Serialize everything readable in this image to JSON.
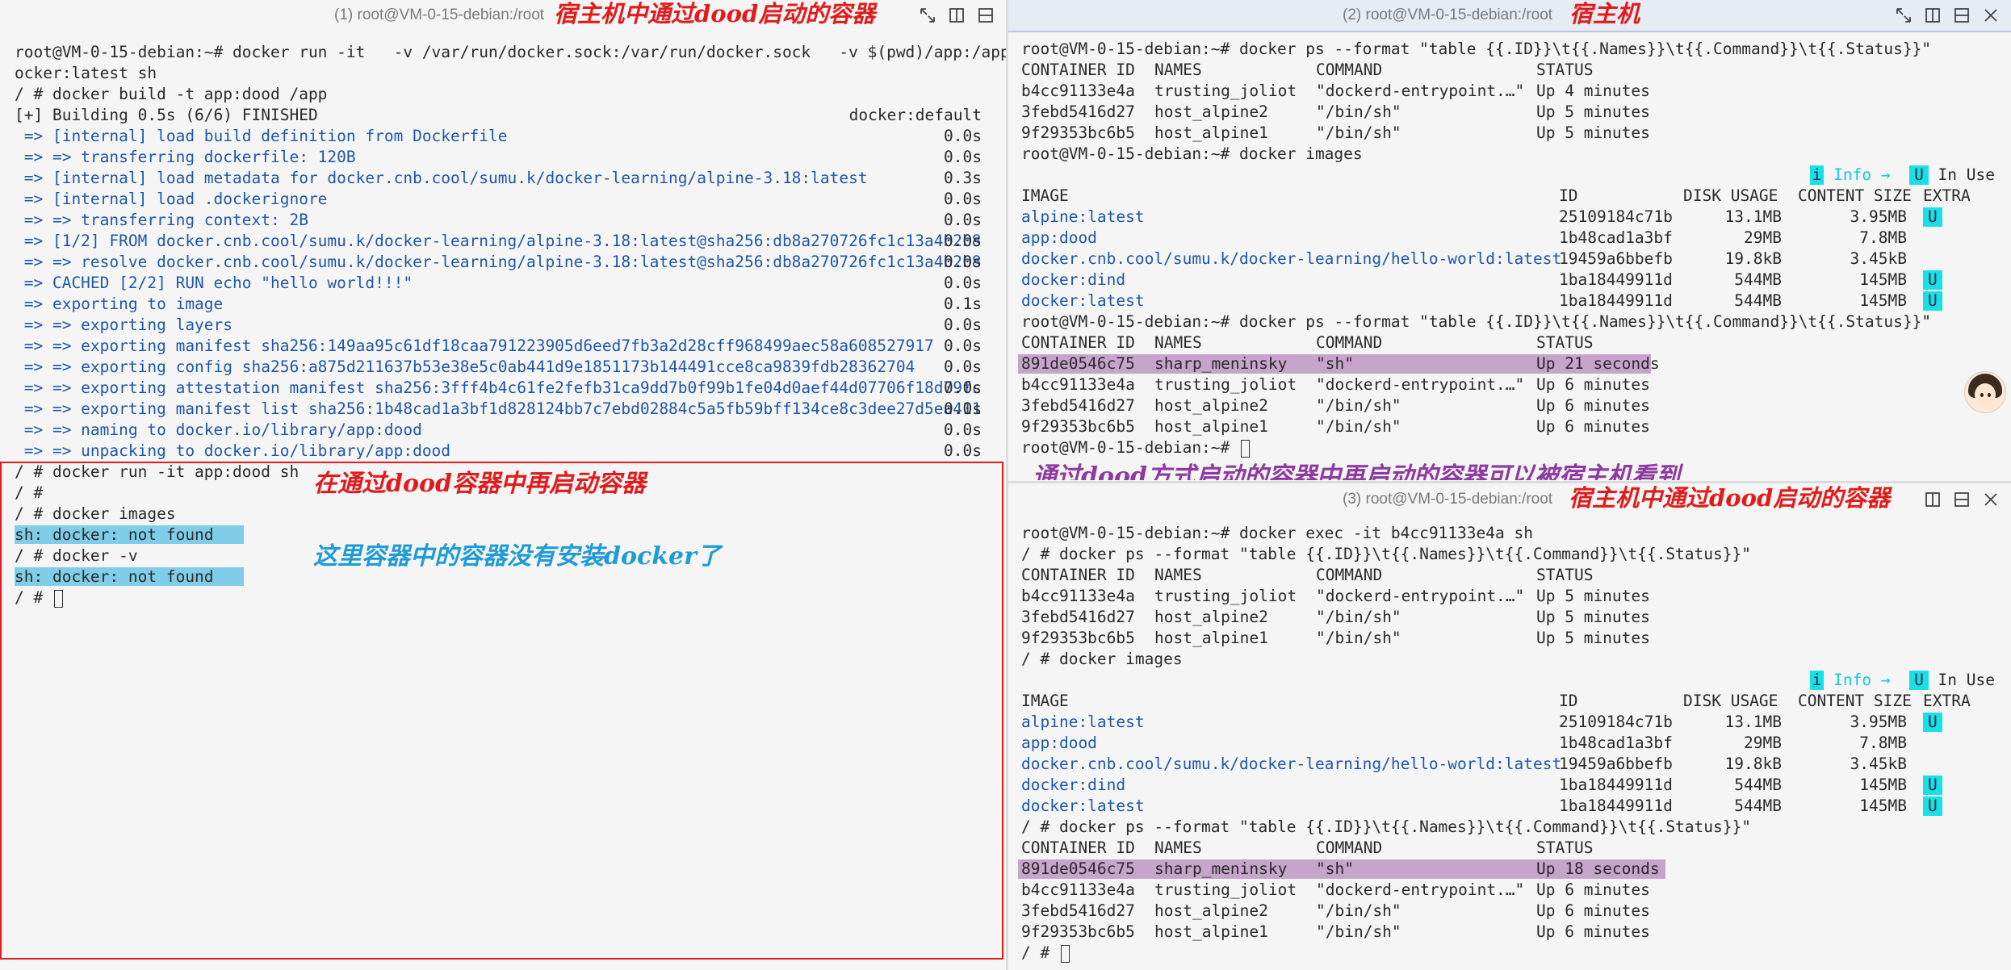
{
  "pane1": {
    "title": "(1)  root@VM-0-15-debian:/root",
    "annotation_title": "宿主机中通过dood启动的容器",
    "lines": [
      {
        "t": "root@VM-0-15-debian:~# docker run -it   -v /var/run/docker.sock:/var/run/docker.sock   -v $(pwd)/app:/app   d"
      },
      {
        "t": "ocker:latest sh"
      },
      {
        "t": "/ # docker build -t app:dood /app"
      },
      {
        "t": "[+] Building 0.5s (6/6) FINISHED",
        "r": "docker:default"
      },
      {
        "t": " => [internal] load build definition from Dockerfile",
        "r": "0.0s",
        "cls": "blue"
      },
      {
        "t": " => => transferring dockerfile: 120B",
        "r": "0.0s",
        "cls": "blue"
      },
      {
        "t": " => [internal] load metadata for docker.cnb.cool/sumu.k/docker-learning/alpine-3.18:latest",
        "r": "0.3s",
        "cls": "blue"
      },
      {
        "t": " => [internal] load .dockerignore",
        "r": "0.0s",
        "cls": "blue"
      },
      {
        "t": " => => transferring context: 2B",
        "r": "0.0s",
        "cls": "blue"
      },
      {
        "t": " => [1/2] FROM docker.cnb.cool/sumu.k/docker-learning/alpine-3.18:latest@sha256:db8a270726fc1c13a4b2b8",
        "r": "0.0s",
        "cls": "blue"
      },
      {
        "t": " => => resolve docker.cnb.cool/sumu.k/docker-learning/alpine-3.18:latest@sha256:db8a270726fc1c13a4b2b8",
        "r": "0.0s",
        "cls": "blue"
      },
      {
        "t": " => CACHED [2/2] RUN echo \"hello world!!!\"",
        "r": "0.0s",
        "cls": "blue"
      },
      {
        "t": " => exporting to image",
        "r": "0.1s",
        "cls": "blue"
      },
      {
        "t": " => => exporting layers",
        "r": "0.0s",
        "cls": "blue"
      },
      {
        "t": " => => exporting manifest sha256:149aa95c61df18caa791223905d6eed7fb3a2d28cff968499aec58a608527917",
        "r": "0.0s",
        "cls": "blue"
      },
      {
        "t": " => => exporting config sha256:a875d211637b53e38e5c0ab441d9e1851173b144491cce8ca9839fdb28362704",
        "r": "0.0s",
        "cls": "blue"
      },
      {
        "t": " => => exporting attestation manifest sha256:3fff4b4c61fe2fefb31ca9dd7b0f99b1fe04d0aef44d07706f18d79fc",
        "r": "0.0s",
        "cls": "blue"
      },
      {
        "t": " => => exporting manifest list sha256:1b48cad1a3bf1d828124bb7c7ebd02884c5a5fb59bff134ce8c3dee27d5ea411",
        "r": "0.0s",
        "cls": "blue"
      },
      {
        "t": " => => naming to docker.io/library/app:dood",
        "r": "0.0s",
        "cls": "blue"
      },
      {
        "t": " => => unpacking to docker.io/library/app:dood",
        "r": "0.0s",
        "cls": "blue"
      },
      {
        "t": "/ # docker run -it app:dood sh"
      },
      {
        "t": "/ #"
      },
      {
        "t": "/ # docker images"
      },
      {
        "t": "sh: docker: not found ",
        "cls": "hl-cyan"
      },
      {
        "t": "/ # docker -v"
      },
      {
        "t": "sh: docker: not found ",
        "cls": "hl-cyan"
      },
      {
        "t": "/ # ",
        "cursor": true
      }
    ],
    "annotation_inner": "在通过dood容器中再启动容器",
    "annotation_note": "这里容器中的容器没有安装docker了"
  },
  "pane2": {
    "title": "(2)  root@VM-0-15-debian:/root",
    "annotation_title": "宿主机",
    "lines": [
      {
        "t": "root@VM-0-15-debian:~# docker ps --format \"table {{.ID}}\\t{{.Names}}\\t{{.Command}}\\t{{.Status}}\""
      },
      {
        "c": [
          "CONTAINER ID",
          "NAMES",
          "COMMAND",
          "STATUS"
        ]
      },
      {
        "c": [
          "b4cc91133e4a",
          "trusting_joliot",
          "\"dockerd-entrypoint.…\"",
          "Up 4 minutes"
        ]
      },
      {
        "c": [
          "3febd5416d27",
          "host_alpine2",
          "\"/bin/sh\"",
          "Up 5 minutes"
        ]
      },
      {
        "c": [
          "9f29353bc6b5",
          "host_alpine1",
          "\"/bin/sh\"",
          "Up 5 minutes"
        ]
      },
      {
        "t": "root@VM-0-15-debian:~# docker images"
      },
      {
        "legend": true
      },
      {
        "img": [
          "IMAGE",
          "ID",
          "DISK USAGE",
          "CONTENT SIZE",
          "EXTRA"
        ],
        "header": true
      },
      {
        "img": [
          "alpine:latest",
          "25109184c71b",
          "13.1MB",
          "3.95MB",
          "U"
        ]
      },
      {
        "img": [
          "app:dood",
          "1b48cad1a3bf",
          "29MB",
          "7.8MB",
          ""
        ]
      },
      {
        "img": [
          "docker.cnb.cool/sumu.k/docker-learning/hello-world:latest",
          "19459a6bbefb",
          "19.8kB",
          "3.45kB",
          ""
        ]
      },
      {
        "img": [
          "docker:dind",
          "1ba18449911d",
          "544MB",
          "145MB",
          "U"
        ]
      },
      {
        "img": [
          "docker:latest",
          "1ba18449911d",
          "544MB",
          "145MB",
          "U"
        ]
      },
      {
        "t": "root@VM-0-15-debian:~# docker ps --format \"table {{.ID}}\\t{{.Names}}\\t{{.Command}}\\t{{.Status}}\""
      },
      {
        "c": [
          "CONTAINER ID",
          "NAMES",
          "COMMAND",
          "STATUS"
        ]
      },
      {
        "c": [
          "891de0546c75",
          "sharp_meninsky",
          "\"sh\"",
          "Up 21 seconds "
        ],
        "hl": true
      },
      {
        "c": [
          "b4cc91133e4a",
          "trusting_joliot",
          "\"dockerd-entrypoint.…\"",
          "Up 6 minutes"
        ]
      },
      {
        "c": [
          "3febd5416d27",
          "host_alpine2",
          "\"/bin/sh\"",
          "Up 6 minutes"
        ]
      },
      {
        "c": [
          "9f29353bc6b5",
          "host_alpine1",
          "\"/bin/sh\"",
          "Up 6 minutes"
        ]
      },
      {
        "t": "root@VM-0-15-debian:~# ",
        "cursor": true
      }
    ],
    "annotation_bottom": "通过dood方式启动的容器中再启动的容器可以被宿主机看到"
  },
  "pane3": {
    "title": "(3)  root@VM-0-15-debian:/root",
    "annotation_title": "宿主机中通过dood启动的容器",
    "lines": [
      {
        "t": "root@VM-0-15-debian:~# docker exec -it b4cc91133e4a sh"
      },
      {
        "t": "/ # docker ps --format \"table {{.ID}}\\t{{.Names}}\\t{{.Command}}\\t{{.Status}}\""
      },
      {
        "c": [
          "CONTAINER ID",
          "NAMES",
          "COMMAND",
          "STATUS"
        ]
      },
      {
        "c": [
          "b4cc91133e4a",
          "trusting_joliot",
          "\"dockerd-entrypoint.…\"",
          "Up 5 minutes"
        ]
      },
      {
        "c": [
          "3febd5416d27",
          "host_alpine2",
          "\"/bin/sh\"",
          "Up 5 minutes"
        ]
      },
      {
        "c": [
          "9f29353bc6b5",
          "host_alpine1",
          "\"/bin/sh\"",
          "Up 5 minutes"
        ]
      },
      {
        "t": "/ # docker images"
      },
      {
        "legend": true
      },
      {
        "img": [
          "IMAGE",
          "ID",
          "DISK USAGE",
          "CONTENT SIZE",
          "EXTRA"
        ],
        "header": true
      },
      {
        "img": [
          "alpine:latest",
          "25109184c71b",
          "13.1MB",
          "3.95MB",
          "U"
        ]
      },
      {
        "img": [
          "app:dood",
          "1b48cad1a3bf",
          "29MB",
          "7.8MB",
          ""
        ]
      },
      {
        "img": [
          "docker.cnb.cool/sumu.k/docker-learning/hello-world:latest",
          "19459a6bbefb",
          "19.8kB",
          "3.45kB",
          ""
        ]
      },
      {
        "img": [
          "docker:dind",
          "1ba18449911d",
          "544MB",
          "145MB",
          "U"
        ]
      },
      {
        "img": [
          "docker:latest",
          "1ba18449911d",
          "544MB",
          "145MB",
          "U"
        ]
      },
      {
        "t": "/ # docker ps --format \"table {{.ID}}\\t{{.Names}}\\t{{.Command}}\\t{{.Status}}\""
      },
      {
        "c": [
          "CONTAINER ID",
          "NAMES",
          "COMMAND",
          "STATUS"
        ]
      },
      {
        "c": [
          "891de0546c75",
          "sharp_meninsky",
          "\"sh\"",
          "Up 18 seconds   "
        ],
        "hl": true
      },
      {
        "c": [
          "b4cc91133e4a",
          "trusting_joliot",
          "\"dockerd-entrypoint.…\"",
          "Up 6 minutes"
        ]
      },
      {
        "c": [
          "3febd5416d27",
          "host_alpine2",
          "\"/bin/sh\"",
          "Up 6 minutes"
        ]
      },
      {
        "c": [
          "9f29353bc6b5",
          "host_alpine1",
          "\"/bin/sh\"",
          "Up 6 minutes"
        ]
      },
      {
        "t": "/ # ",
        "cursor": true
      }
    ]
  },
  "legend": {
    "i": "i",
    "info": "Info →",
    "u": "U",
    "in_use": "In Use"
  },
  "icons": [
    "expand-icon",
    "split-vertical-icon",
    "split-horizontal-icon",
    "close-icon"
  ],
  "colors": {
    "annotation_red": "#e11b1b",
    "annotation_blue": "#1f9bd6",
    "annotation_purple": "#8e3aa0",
    "highlight_purple": "#c7a4cc",
    "highlight_cyan": "#7fcde8",
    "badge_cyan": "#19e0e6"
  }
}
